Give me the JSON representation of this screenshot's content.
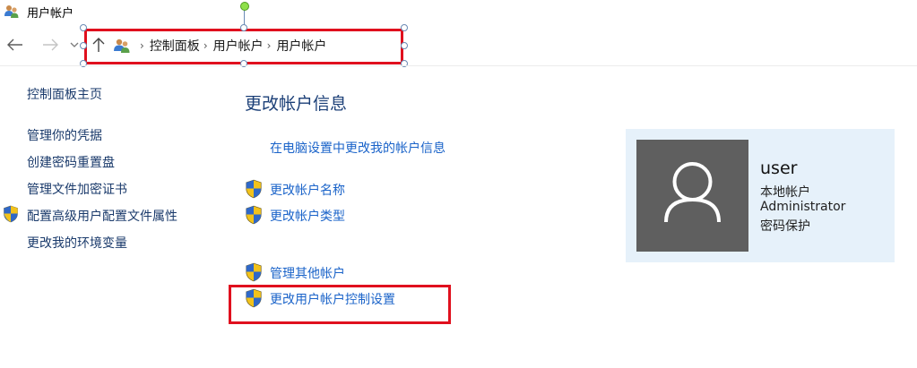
{
  "window": {
    "title": "用户帐户"
  },
  "nav": {
    "back_icon": "back-arrow-icon",
    "forward_icon": "forward-arrow-icon",
    "recent_icon": "chevron-down-icon",
    "up_icon": "up-arrow-icon",
    "breadcrumb": [
      "控制面板",
      "用户帐户",
      "用户帐户"
    ]
  },
  "sidebar": {
    "home_link": "控制面板主页",
    "links": [
      {
        "label": "管理你的凭据",
        "shield": false
      },
      {
        "label": "创建密码重置盘",
        "shield": false
      },
      {
        "label": "管理文件加密证书",
        "shield": false
      },
      {
        "label": "配置高级用户配置文件属性",
        "shield": true
      },
      {
        "label": "更改我的环境变量",
        "shield": false
      }
    ]
  },
  "main": {
    "title": "更改帐户信息",
    "pc_settings_link": "在电脑设置中更改我的帐户信息",
    "actions": [
      {
        "label": "更改帐户名称",
        "shield": true
      },
      {
        "label": "更改帐户类型",
        "shield": true
      },
      {
        "label": "管理其他帐户",
        "shield": true
      },
      {
        "label": "更改用户帐户控制设置",
        "shield": true
      }
    ]
  },
  "user": {
    "name": "user",
    "account_type": "本地帐户",
    "role": "Administrator",
    "password_status": "密码保护"
  },
  "colors": {
    "highlight_border": "#e0101e",
    "link": "#1a63c9",
    "title": "#1b3f77",
    "card_bg": "#e6f1fa",
    "avatar_bg": "#5f5f5f"
  }
}
